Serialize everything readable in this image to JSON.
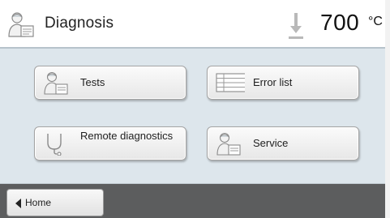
{
  "header": {
    "title": "Diagnosis",
    "title_icon": "technician-icon",
    "temperature_icon": "temperature-down-arrow-icon",
    "temperature_value": "700",
    "temperature_unit": "°C"
  },
  "menu": {
    "buttons": [
      {
        "label": "Tests",
        "icon": "technician-icon"
      },
      {
        "label": "Error list",
        "icon": "table-icon"
      },
      {
        "label": "Remote diagnostics",
        "icon": "stethoscope-icon"
      },
      {
        "label": "Service",
        "icon": "technician-icon"
      }
    ]
  },
  "footer": {
    "home_label": "Home",
    "home_icon": "back-arrow-icon"
  },
  "colors": {
    "panel": "#dde6ec",
    "footer": "#5c5d5e",
    "divider": "#b7c3cb"
  }
}
